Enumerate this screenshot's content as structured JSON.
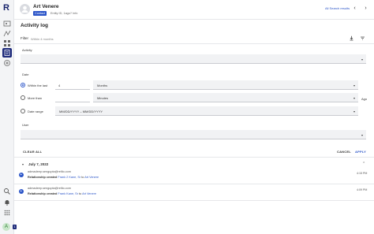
{
  "rail": {
    "logo": "R",
    "avatar_initial": "A",
    "badge": "1"
  },
  "header": {
    "name": "Art Venere",
    "tag": "Contact",
    "meta": "Entity ID, 1ago? Info",
    "search_results": "All Search results",
    "prev": "‹",
    "next": "›"
  },
  "page": {
    "title": "Activity log",
    "filter_label": "Filter",
    "filter_value": "Within 4 months"
  },
  "filters": {
    "activity_label": "Activity",
    "date_label": "Date",
    "within_label": "Within the last",
    "within_value": "4",
    "within_unit": "Months",
    "more_label": "More than",
    "more_unit": "Minutes",
    "ago": "Ago",
    "range_label": "Date range",
    "range_value": "MM/DD/YYYY – MM/DD/YYYY",
    "user_label": "User",
    "clear": "CLEAR ALL",
    "cancel": "CANCEL",
    "apply": "APPLY"
  },
  "log": {
    "date_caret": "▾",
    "date": "July 7, 2022",
    "collapse": "⌃",
    "entries": [
      {
        "who": "admadeep.sengupta@reltio.com",
        "action": "Relationship created",
        "from": "Frank 2 Kane, Sr",
        "to_word": "to",
        "target": "Art Venere",
        "time": "4:15 PM"
      },
      {
        "who": "admadeep.sengupta@reltio.com",
        "action": "Relationship created",
        "from": "Frank Kane, Sr",
        "to_word": "to",
        "target": "Art Venere",
        "time": "4:09 PM"
      }
    ]
  },
  "colors": {
    "accent": "#2a54c8",
    "rail_active": "#1d2a7a"
  }
}
